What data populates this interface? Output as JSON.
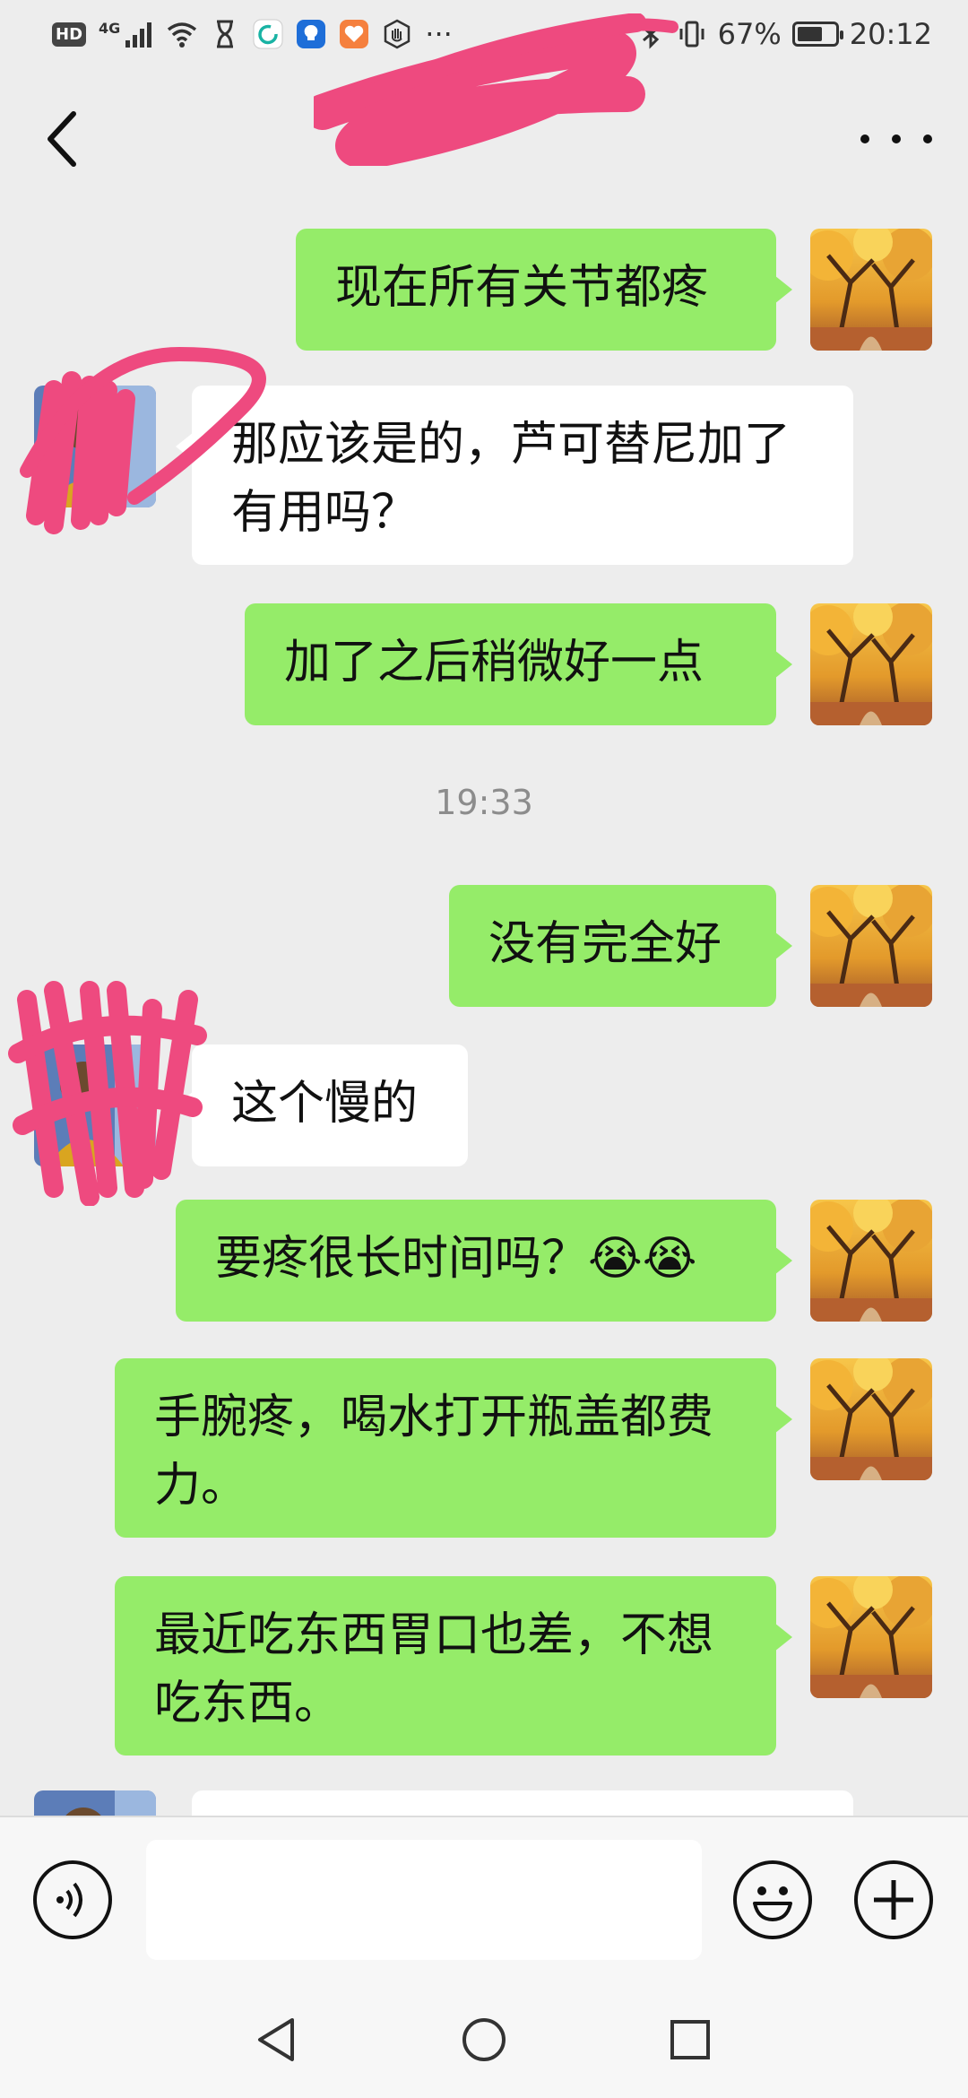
{
  "status_bar": {
    "network": "4G",
    "more": "···",
    "battery": "67%",
    "battery_level": 0.67,
    "time": "20:12"
  },
  "chat_title": "",
  "composer": {
    "placeholder": ""
  },
  "timestamp": "19:33",
  "messages": [
    {
      "side": "self",
      "text": "现在所有关节都疼"
    },
    {
      "side": "other",
      "text": "那应该是的，芦可替尼加了有用吗？"
    },
    {
      "side": "self",
      "text": "加了之后稍微好一点"
    },
    {
      "side": "self",
      "text": "没有完全好"
    },
    {
      "side": "other",
      "text": "这个慢的"
    },
    {
      "side": "self",
      "text": "要疼很长时间吗？😭😭"
    },
    {
      "side": "self",
      "text": "手腕疼，喝水打开瓶盖都费力。"
    },
    {
      "side": "self",
      "text": "最近吃东西胃口也差，不想吃东西。"
    },
    {
      "side": "other",
      "text": ""
    }
  ],
  "colors": {
    "self_bubble": "#95ec69",
    "other_bubble": "#ffffff",
    "background": "#ededed",
    "redaction": "#ee4a7f"
  },
  "icons": {
    "back": "chevron-left-icon",
    "more": "more-dots-icon",
    "voice": "voice-icon",
    "emoji": "emoji-icon",
    "plus": "plus-icon",
    "nav_back": "triangle-back-icon",
    "nav_home": "circle-home-icon",
    "nav_recent": "square-recent-icon"
  }
}
